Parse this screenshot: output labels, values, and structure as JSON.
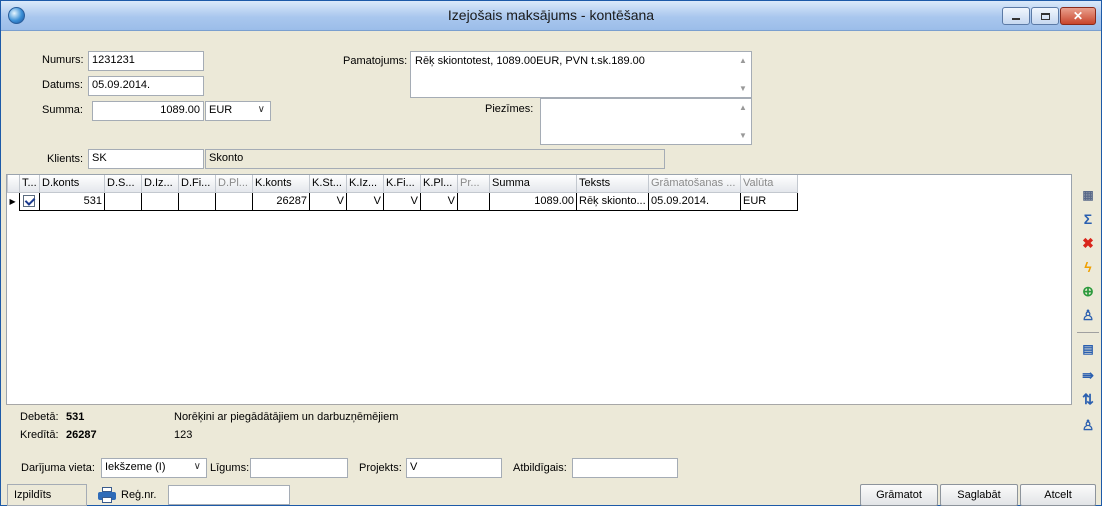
{
  "window": {
    "title": "Izejošais maksājums - kontēšana"
  },
  "form": {
    "numurs_label": "Numurs:",
    "numurs_value": "1231231",
    "datums_label": "Datums:",
    "datums_value": "05.09.2014.",
    "summa_label": "Summa:",
    "summa_value": "1089.00",
    "currency": "EUR",
    "pamatojums_label": "Pamatojums:",
    "pamatojums_value": "Rēķ skiontotest, 1089.00EUR, PVN t.sk.189.00",
    "piezimes_label": "Piezīmes:",
    "piezimes_value": "",
    "klients_label": "Klients:",
    "klients_code": "SK",
    "klients_name": "Skonto"
  },
  "grid": {
    "columns": [
      "T...",
      "D.konts",
      "D.S...",
      "D.Iz...",
      "D.Fi...",
      "D.Pl...",
      "K.konts",
      "K.St...",
      "K.Iz...",
      "K.Fi...",
      "K.Pl...",
      "Pr...",
      "Summa",
      "Teksts",
      "Grāmatošanas ...",
      "Valūta"
    ],
    "rows": [
      {
        "checked": true,
        "d_konts": "531",
        "d_s": "",
        "d_iz": "",
        "d_fi": "",
        "d_pl": "",
        "k_konts": "26287",
        "k_st": "V",
        "k_iz": "V",
        "k_fi": "V",
        "k_pl": "V",
        "pr": "",
        "summa": "1089.00",
        "teksts": "Rēķ skionto...",
        "gramatosanas": "05.09.2014.",
        "valuta": "EUR"
      }
    ]
  },
  "info": {
    "debeta_label": "Debetā:",
    "debeta_value": "531",
    "debeta_desc": "Norēķini ar piegādātājiem un darbuzņēmējiem",
    "kredita_label": "Kredītā:",
    "kredita_value": "26287",
    "kredita_desc": "123"
  },
  "bottom_fields": {
    "darijuma_vieta_label": "Darījuma vieta:",
    "darijuma_vieta_value": "Iekšzeme (I)",
    "ligums_label": "Līgums:",
    "ligums_value": "",
    "projekts_label": "Projekts:",
    "projekts_value": "V",
    "atbildigais_label": "Atbildīgais:",
    "atbildigais_value": ""
  },
  "footer": {
    "status": "Izpildīts",
    "reg_nr_label": "Reģ.nr.",
    "reg_nr_value": "",
    "gramatot": "Grāmatot",
    "saglabat": "Saglabāt",
    "atcelt": "Atcelt"
  },
  "icons": [
    "columns-icon",
    "sum-icon",
    "delete-icon",
    "lightning-icon",
    "add-icon",
    "person-icon",
    "export-icon",
    "import-icon",
    "sort-icon",
    "user-search-icon"
  ],
  "colors": {
    "title_bar": "#a9c7ee",
    "window_bg": "#ece9d8",
    "close_button": "#c8452c"
  }
}
